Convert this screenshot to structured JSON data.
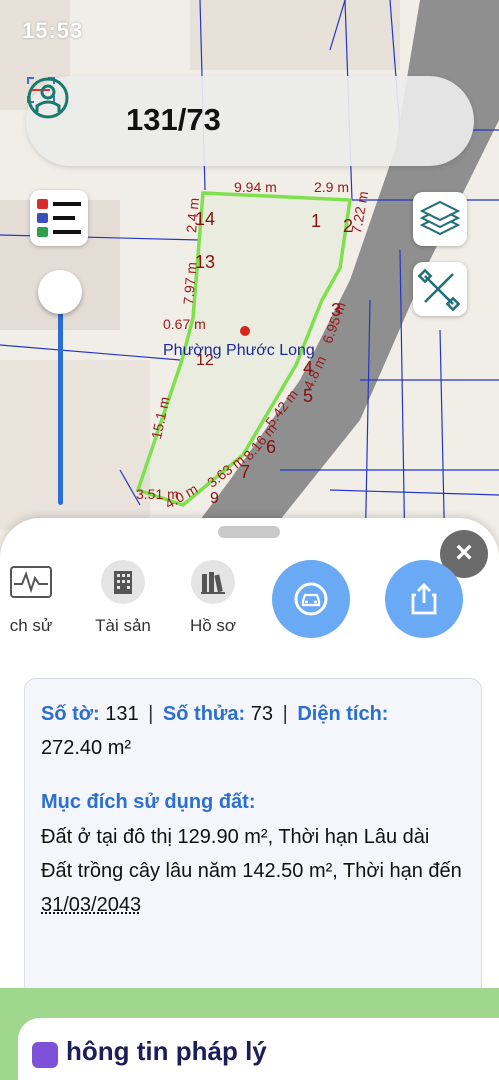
{
  "status_bar": {
    "time": "15:53"
  },
  "search": {
    "query": "131/73"
  },
  "map": {
    "ward_label": "Phường Phước Long",
    "dimensions": [
      "9.94 m",
      "2.9 m",
      "7.22 m",
      "6.95 m",
      "7.97 m",
      "0.67 m",
      "15.1 m",
      "5.42 m",
      "8.16 m",
      "3.63 m",
      "4.0 m",
      "3.51 m",
      "4.8 m",
      "2.4 m"
    ],
    "vertex_labels": [
      "14",
      "13",
      "1",
      "2",
      "3",
      "4",
      "5",
      "6",
      "7",
      "8",
      "9",
      "12"
    ],
    "colors": {
      "parcel_outline": "#7ee04d",
      "road": "#8f8f8f",
      "boundary": "#2437c4",
      "dim_text": "#9b1a1a"
    }
  },
  "buttons": {
    "legend": "legend-icon",
    "layers": "layers-icon",
    "measure": "ruler-icon"
  },
  "sheet": {
    "tabs": [
      {
        "label": "ch sử",
        "icon": "history-chart-icon"
      },
      {
        "label": "Tài sản",
        "icon": "building-icon"
      },
      {
        "label": "Hồ sơ",
        "icon": "books-icon"
      }
    ],
    "actions": [
      "car-icon",
      "share-icon"
    ],
    "info": {
      "sheet_label": "Số tờ:",
      "sheet_value": "131",
      "parcel_label": "Số thửa:",
      "parcel_value": "73",
      "area_label": "Diện tích:",
      "area_value": "272.40 m²",
      "separator": "|",
      "purpose_title": "Mục đích sử dụng đất:",
      "purpose_text": "Đất ở tại đô thị 129.90 m², Thời hạn Lâu dài Đất trồng cây lâu năm 142.50 m², Thời hạn đến",
      "purpose_date": "31/03/2043"
    },
    "legal_title": "hông tin pháp lý",
    "close": "×"
  }
}
